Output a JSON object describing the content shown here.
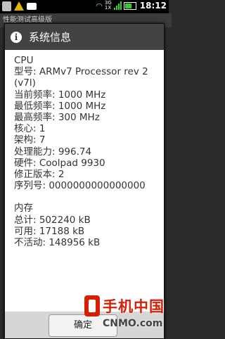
{
  "status_bar": {
    "time": "18:12",
    "network": "3G\n1X"
  },
  "app_bar": {
    "title": "性能测试高级版"
  },
  "dialog": {
    "title": "系统信息",
    "cpu": {
      "heading": "CPU",
      "lines": [
        "型号: ARMv7 Processor rev 2 (v7l)",
        "当前频率: 1000 MHz",
        "最低频率: 1000 MHz",
        "最高频率: 300 MHz",
        "核心: 1",
        "架构: 7",
        "处理能力: 996.74",
        "硬件: Coolpad 9930",
        "修正版本: 2",
        "序列号: 0000000000000000"
      ]
    },
    "memory": {
      "heading": "内存",
      "lines": [
        "总计: 502240 kB",
        "可用: 17188 kB",
        "不活动: 148956 kB"
      ]
    },
    "ok_label": "确定"
  },
  "watermark": {
    "brand_cn": "手机中国",
    "brand_en": "CNMO.com"
  }
}
